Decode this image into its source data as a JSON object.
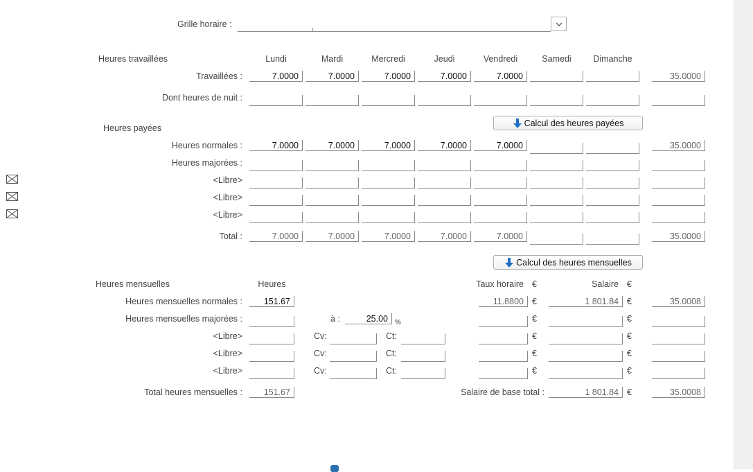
{
  "grille": {
    "label": "Grille horaire :",
    "value": ""
  },
  "days": [
    "Lundi",
    "Mardi",
    "Mercredi",
    "Jeudi",
    "Vendredi",
    "Samedi",
    "Dimanche"
  ],
  "worked": {
    "section_title": "Heures travaillées",
    "row_travaillees": {
      "label": "Travaillées :",
      "values": [
        "7.0000",
        "7.0000",
        "7.0000",
        "7.0000",
        "7.0000",
        "",
        ""
      ],
      "total": "35.0000"
    },
    "row_nuit": {
      "label": "Dont heures de nuit :",
      "values": [
        "",
        "",
        "",
        "",
        "",
        "",
        ""
      ],
      "total": ""
    }
  },
  "calc_paid_button": "Calcul des heures payées",
  "paid": {
    "section_title": "Heures payées",
    "row_normales": {
      "label": "Heures normales :",
      "values": [
        "7.0000",
        "7.0000",
        "7.0000",
        "7.0000",
        "7.0000",
        "",
        ""
      ],
      "total": "35.0000"
    },
    "row_majorees": {
      "label": "Heures majorées :",
      "values": [
        "",
        "",
        "",
        "",
        "",
        "",
        ""
      ],
      "total": ""
    },
    "row_libre1": {
      "label": "<Libre>",
      "values": [
        "",
        "",
        "",
        "",
        "",
        "",
        ""
      ],
      "total": ""
    },
    "row_libre2": {
      "label": "<Libre>",
      "values": [
        "",
        "",
        "",
        "",
        "",
        "",
        ""
      ],
      "total": ""
    },
    "row_libre3": {
      "label": "<Libre>",
      "values": [
        "",
        "",
        "",
        "",
        "",
        "",
        ""
      ],
      "total": ""
    },
    "row_total": {
      "label": "Total :",
      "values": [
        "7.0000",
        "7.0000",
        "7.0000",
        "7.0000",
        "7.0000",
        "",
        ""
      ],
      "total": "35.0000"
    }
  },
  "calc_monthly_button": "Calcul des heures mensuelles",
  "monthly": {
    "section_title": "Heures mensuelles",
    "col_heures": "Heures",
    "col_taux": "Taux horaire",
    "col_salaire": "Salaire",
    "currency": "€",
    "a_label": "à :",
    "a_value": "25.00",
    "percent": "%",
    "cv_label": "Cv:",
    "ct_label": "Ct:",
    "row_normales": {
      "label": "Heures mensuelles normales :",
      "heures": "151.67",
      "taux": "11.8800",
      "salaire": "1 801.84",
      "right": "35.0008"
    },
    "row_majorees": {
      "label": "Heures mensuelles majorées :",
      "heures": "",
      "taux": "",
      "salaire": "",
      "right": ""
    },
    "row_libre1": {
      "label": "<Libre>",
      "heures": "",
      "cv": "",
      "ct": "",
      "taux": "",
      "salaire": "",
      "right": ""
    },
    "row_libre2": {
      "label": "<Libre>",
      "heures": "",
      "cv": "",
      "ct": "",
      "taux": "",
      "salaire": "",
      "right": ""
    },
    "row_libre3": {
      "label": "<Libre>",
      "heures": "",
      "cv": "",
      "ct": "",
      "taux": "",
      "salaire": "",
      "right": ""
    },
    "total_heures": {
      "label": "Total heures mensuelles :",
      "value": "151.67"
    },
    "salaire_base": {
      "label": "Salaire de base total :",
      "value": "1 801.84",
      "right": "35.0008"
    }
  },
  "side_icons": [
    "envelope-icon",
    "envelope-icon",
    "envelope-icon"
  ],
  "colors": {
    "accent_arrow": "#1f6fc4"
  }
}
